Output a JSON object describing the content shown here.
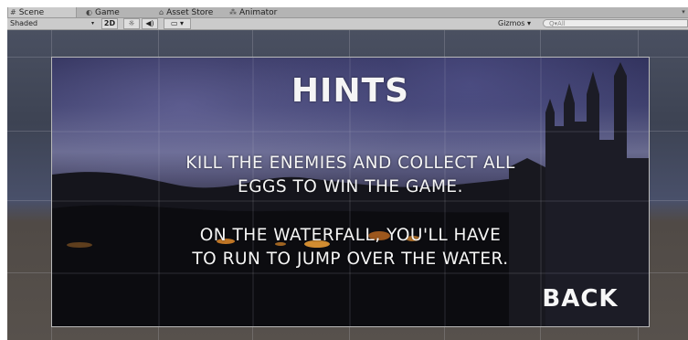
{
  "tabs": {
    "scene": {
      "label": "Scene",
      "icon": "grid-icon"
    },
    "game": {
      "label": "Game",
      "icon": "pacman-icon"
    },
    "asset_store": {
      "label": "Asset Store",
      "icon": "basket-icon"
    },
    "animator": {
      "label": "Animator",
      "icon": "nodes-icon"
    }
  },
  "toolbar": {
    "shading_mode": "Shaded",
    "toggle_2d": "2D",
    "gizmos": "Gizmos",
    "search_placeholder": "All"
  },
  "hints_menu": {
    "title": "HINTS",
    "paragraph1_line1": "KILL THE ENEMIES AND COLLECT ALL",
    "paragraph1_line2": "EGGS TO WIN THE GAME.",
    "paragraph2_line1": "ON THE WATERFALL, YOU'LL HAVE",
    "paragraph2_line2": "TO RUN TO JUMP OVER THE WATER.",
    "back_label": "BACK"
  }
}
